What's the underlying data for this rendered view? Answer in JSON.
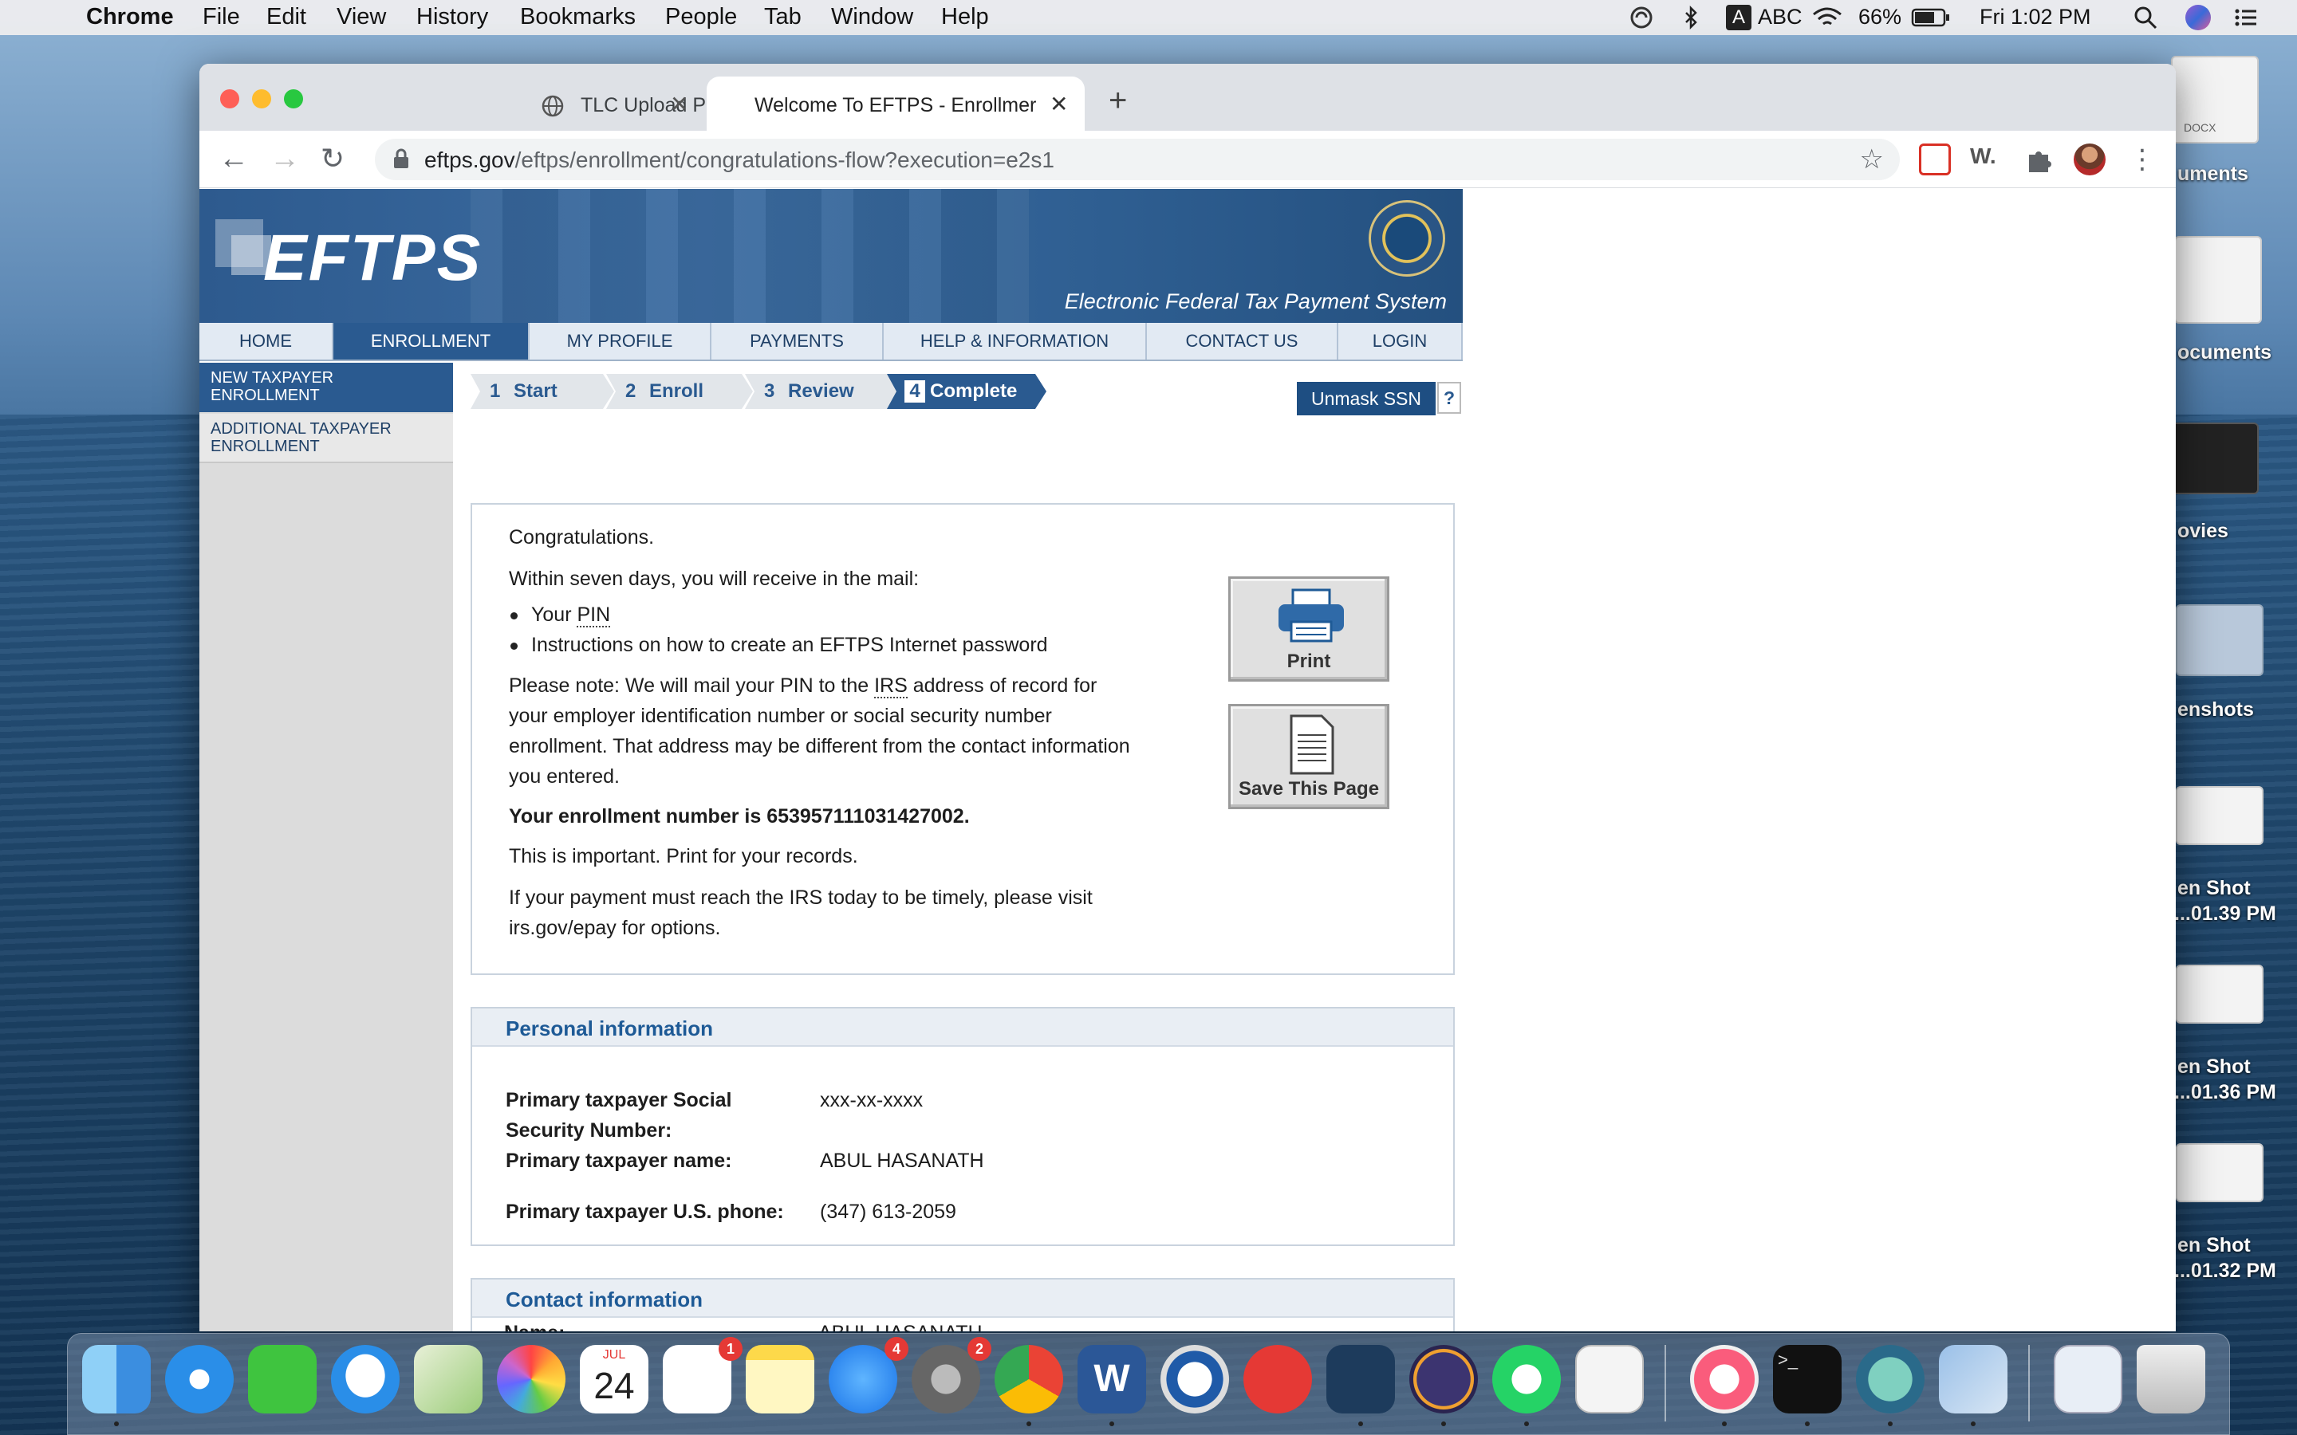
{
  "menubar": {
    "app_name": "Chrome",
    "items": [
      "File",
      "Edit",
      "View",
      "History",
      "Bookmarks",
      "People",
      "Tab",
      "Window",
      "Help"
    ],
    "input_source": "ABC",
    "battery": "66%",
    "clock": "Fri 1:02 PM"
  },
  "desktop": {
    "labels": [
      "uments",
      "ocuments",
      "ovies",
      "enshots",
      "en Shot",
      "...01.39 PM",
      "en Shot",
      "...01.36 PM",
      "en Shot",
      "...01.32 PM"
    ],
    "docx_label": "DOCX"
  },
  "browser": {
    "tabs": [
      {
        "title": "TLC Upload Portal",
        "icon": "globe-icon"
      },
      {
        "title": "Welcome To EFTPS - Enrollmer",
        "icon": "none"
      }
    ],
    "new_tab": "+",
    "url_host": "eftps.gov",
    "url_path": "/eftps/enrollment/congratulations-flow?execution=e2s1",
    "ext_w": "W."
  },
  "site": {
    "logo": "EFTPS",
    "tagline": "Electronic Federal Tax Payment System",
    "nav": [
      "HOME",
      "ENROLLMENT",
      "MY PROFILE",
      "PAYMENTS",
      "HELP & INFORMATION",
      "CONTACT US",
      "LOGIN"
    ],
    "nav_active": "ENROLLMENT",
    "sidebar": [
      "NEW TAXPAYER ENROLLMENT",
      "ADDITIONAL TAXPAYER ENROLLMENT"
    ],
    "steps": [
      {
        "num": "1",
        "label": "Start"
      },
      {
        "num": "2",
        "label": "Enroll"
      },
      {
        "num": "3",
        "label": "Review"
      },
      {
        "num": "4",
        "label": "Complete"
      }
    ],
    "unmask_label": "Unmask SSN",
    "help_label": "?"
  },
  "confirmation": {
    "congrats": "Congratulations.",
    "mail_intro": "Within seven days, you will receive in the mail:",
    "bullet_pin_prefix": "Your ",
    "bullet_pin_abbr": "PIN",
    "bullet_instructions": "Instructions on how to create an EFTPS Internet password",
    "note_line1_a": "Please note: We will mail your PIN to the ",
    "note_line1_abbr": "IRS",
    "note_line1_b": " address of record for",
    "note_line2": "your employer identification number or social security number",
    "note_line3": "enrollment. That address may be different from the contact information",
    "note_line4": "you entered.",
    "enrollment_number": "Your enrollment number is 653957111031427002.",
    "important": "This is important. Print for your records.",
    "payment_line1": "If your payment must reach the IRS today to be timely, please visit",
    "payment_line2": "irs.gov/epay for options.",
    "print_label": "Print",
    "save_label": "Save This Page"
  },
  "personal": {
    "header": "Personal information",
    "ssn_label_1": "Primary taxpayer Social",
    "ssn_label_2": "Security Number:",
    "ssn_value": "xxx-xx-xxxx",
    "name_label": "Primary taxpayer name:",
    "name_value": "ABUL HASANATH",
    "phone_label": "Primary taxpayer U.S. phone:",
    "phone_value": "(347) 613-2059"
  },
  "contact": {
    "header": "Contact information",
    "name_label": "Name:",
    "name_value": "ABUL HASANATH"
  },
  "dock": {
    "calendar_month": "JUL",
    "calendar_day": "24",
    "reminders_badge": "1",
    "appstore_badge": "4",
    "prefs_badge": "2"
  }
}
